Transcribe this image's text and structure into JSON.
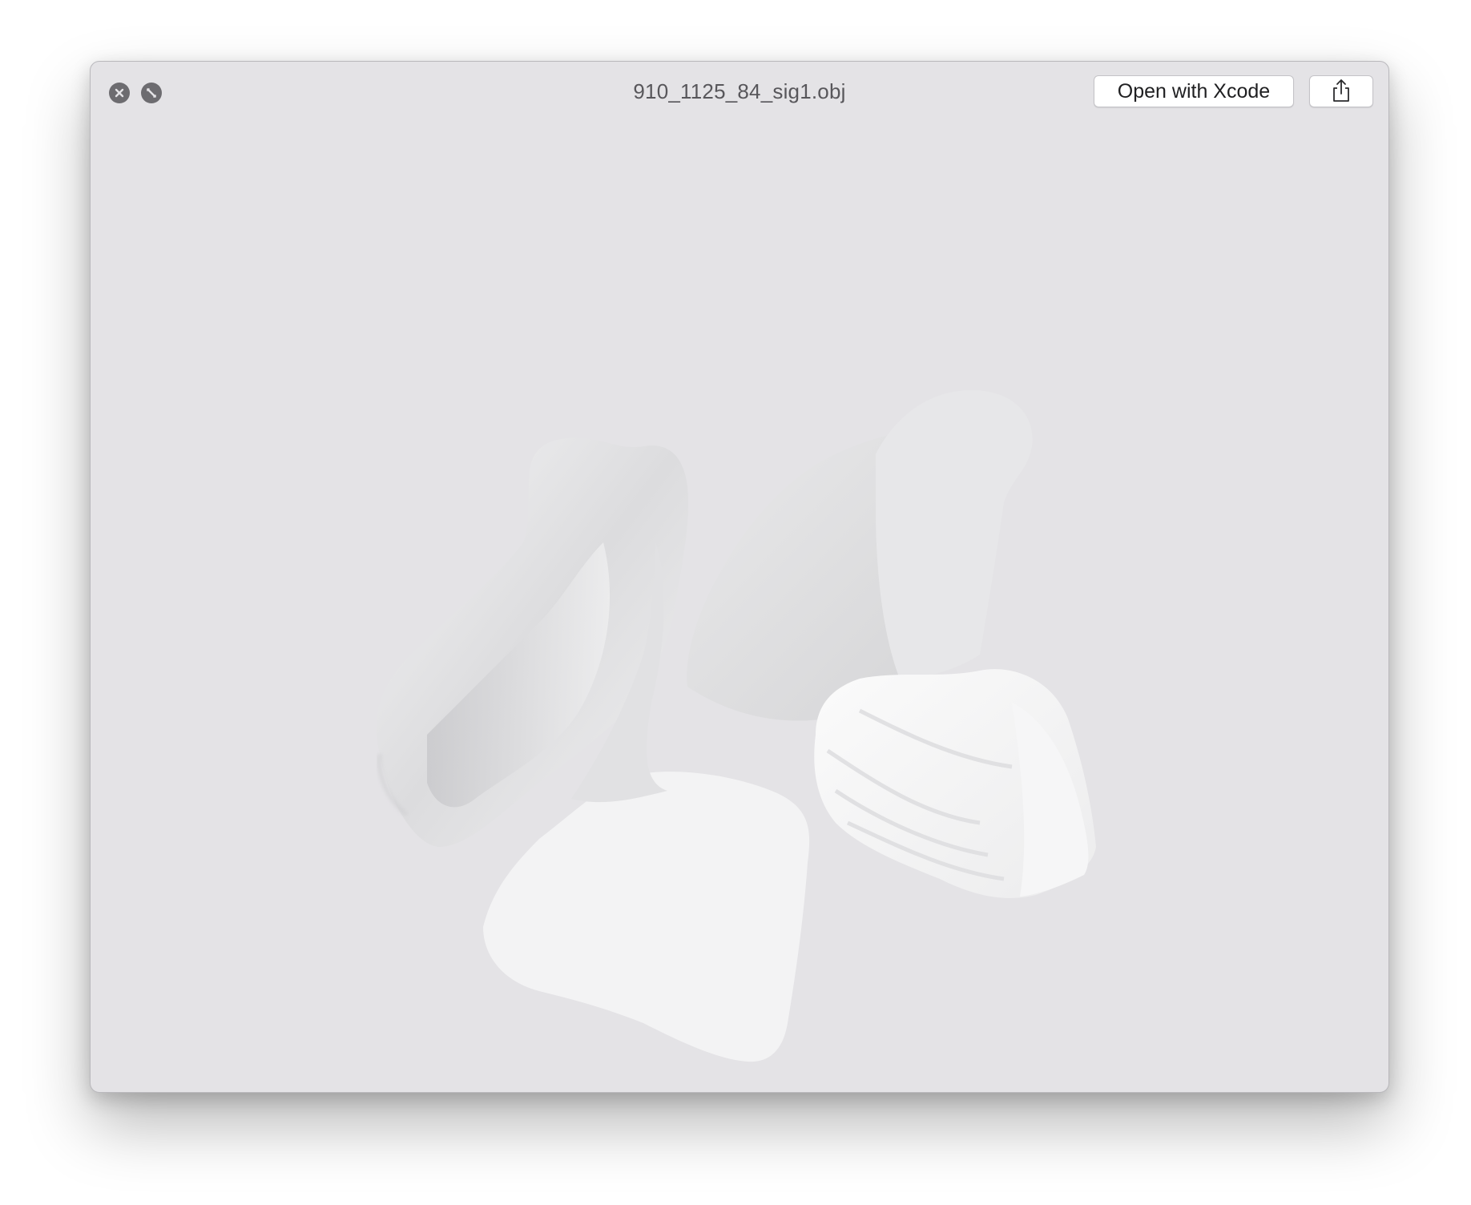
{
  "window": {
    "title": "910_1125_84_sig1.obj",
    "traffic_lights": [
      {
        "role": "close",
        "icon": "close-x-icon"
      },
      {
        "role": "fullscreen",
        "icon": "fullscreen-arrows-icon"
      }
    ]
  },
  "toolbar": {
    "open_with_label": "Open with Xcode",
    "share_icon": "share-icon"
  },
  "viewer": {
    "content": "3d-model-preview",
    "background_color": "#e4e3e6",
    "model_color": "#f2f2f3"
  }
}
